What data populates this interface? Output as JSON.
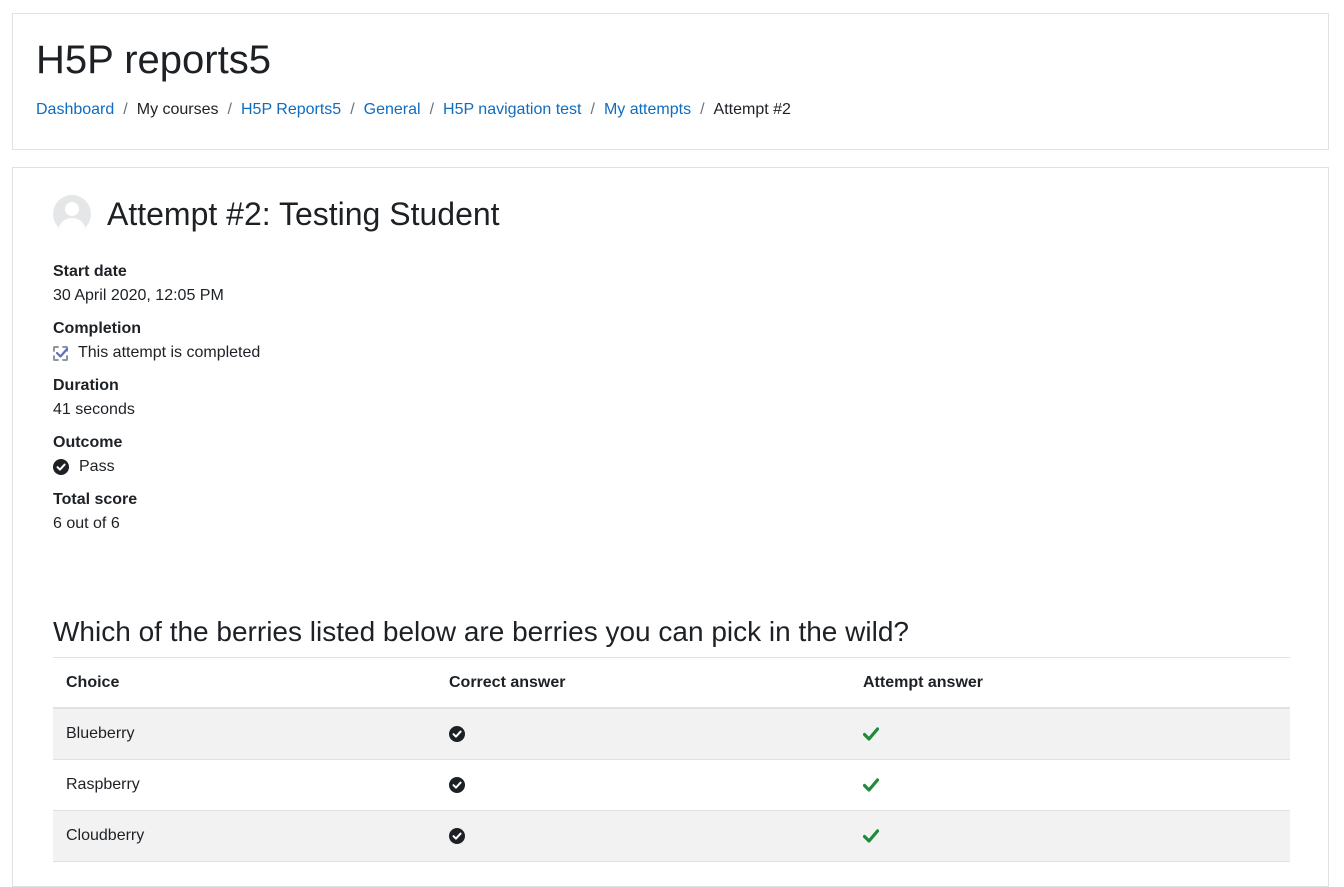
{
  "page": {
    "title": "H5P reports5"
  },
  "breadcrumb": [
    {
      "label": "Dashboard",
      "link": true
    },
    {
      "label": "My courses",
      "link": false
    },
    {
      "label": "H5P Reports5",
      "link": true
    },
    {
      "label": "General",
      "link": true
    },
    {
      "label": "H5P navigation test",
      "link": true
    },
    {
      "label": "My attempts",
      "link": true
    },
    {
      "label": "Attempt #2",
      "link": false
    }
  ],
  "attempt": {
    "title": "Attempt #2: Testing Student",
    "start_date": {
      "label": "Start date",
      "value": "30 April 2020, 12:05 PM"
    },
    "completion": {
      "label": "Completion",
      "value": "This attempt is completed",
      "icon": "completion-checkbox-icon"
    },
    "duration": {
      "label": "Duration",
      "value": "41 seconds"
    },
    "outcome": {
      "label": "Outcome",
      "value": "Pass",
      "icon": "check-circle-icon"
    },
    "total_score": {
      "label": "Total score",
      "value": "6 out of 6"
    }
  },
  "question": {
    "text": "Which of the berries listed below are berries you can pick in the wild?",
    "columns": [
      "Choice",
      "Correct answer",
      "Attempt answer"
    ],
    "rows": [
      {
        "choice": "Blueberry",
        "correct": "check-circle-icon",
        "attempt": "green-check-icon"
      },
      {
        "choice": "Raspberry",
        "correct": "check-circle-icon",
        "attempt": "green-check-icon"
      },
      {
        "choice": "Cloudberry",
        "correct": "check-circle-icon",
        "attempt": "green-check-icon"
      }
    ]
  },
  "colors": {
    "link": "#0f6cbf",
    "text": "#1d2125",
    "success": "#1f8a3b",
    "stripe": "#f2f2f2",
    "border": "#dee2e6"
  }
}
